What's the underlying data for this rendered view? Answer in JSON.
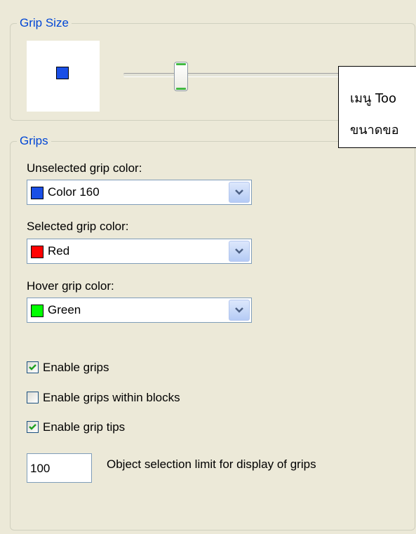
{
  "grip_size": {
    "title": "Grip Size",
    "preview_color": "#1a4fe6"
  },
  "tooltip": {
    "line1": "เมนู Too",
    "line2": "ขนาดขอ"
  },
  "grips": {
    "title": "Grips",
    "unselected": {
      "label": "Unselected grip color:",
      "value": "Color 160",
      "swatch": "#1a4fe6"
    },
    "selected": {
      "label": "Selected grip color:",
      "value": "Red",
      "swatch": "#ff0000"
    },
    "hover": {
      "label": "Hover grip color:",
      "value": "Green",
      "swatch": "#00ff00"
    },
    "checkboxes": [
      {
        "label": "Enable grips",
        "checked": true
      },
      {
        "label": "Enable grips within blocks",
        "checked": false
      },
      {
        "label": "Enable grip tips",
        "checked": true
      }
    ],
    "selection_limit": {
      "value": "100",
      "label": "Object selection limit for display of grips"
    }
  }
}
